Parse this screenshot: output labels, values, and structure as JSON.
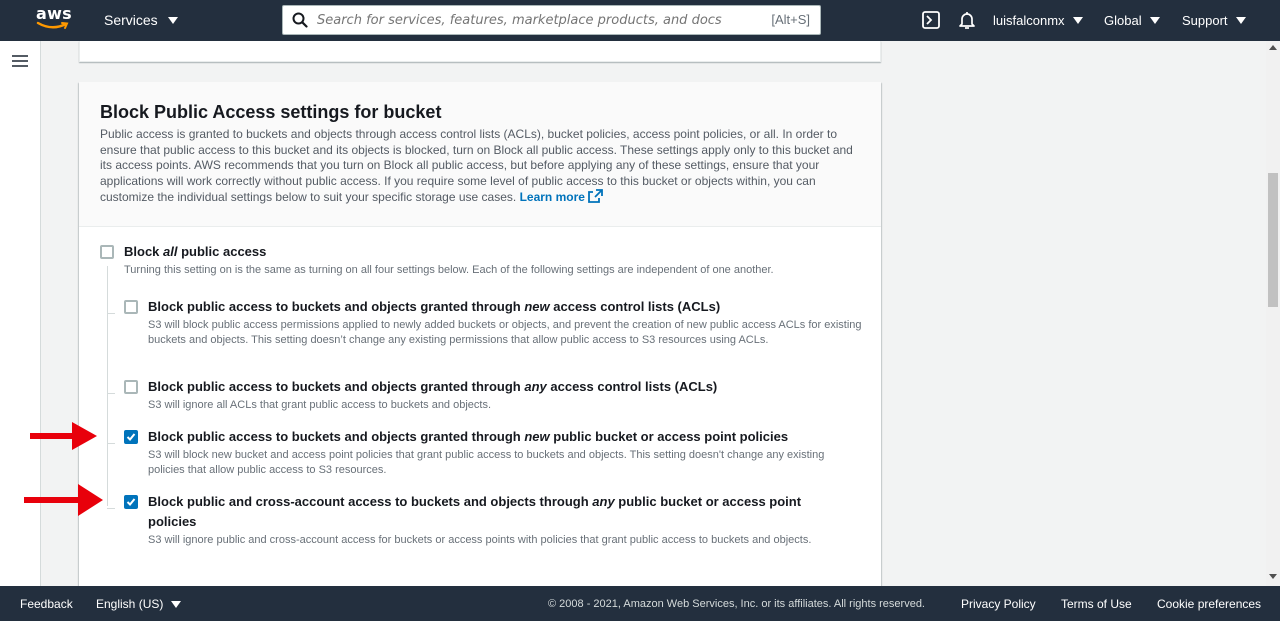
{
  "topnav": {
    "logo_text": "aws",
    "services_label": "Services",
    "search_placeholder": "Search for services, features, marketplace products, and docs",
    "search_shortcut": "[Alt+S]",
    "account_label": "luisfalconmx",
    "region_label": "Global",
    "support_label": "Support",
    "icons": [
      "cloudshell-icon",
      "bell-icon"
    ]
  },
  "card": {
    "title": "Block Public Access settings for bucket",
    "description": "Public access is granted to buckets and objects through access control lists (ACLs), bucket policies, access point policies, or all. In order to ensure that public access to this bucket and its objects is blocked, turn on Block all public access. These settings apply only to this bucket and its access points. AWS recommends that you turn on Block all public access, but before applying any of these settings, ensure that your applications will work correctly without public access. If you require some level of public access to this bucket or objects within, you can customize the individual settings below to suit your specific storage use cases.",
    "learn_more": "Learn more"
  },
  "block_all": {
    "title_pre": "Block ",
    "title_em": "all",
    "title_post": " public access",
    "description": "Turning this setting on is the same as turning on all four settings below. Each of the following settings are independent of one another.",
    "checked": false
  },
  "options": [
    {
      "title_pre": "Block public access to buckets and objects granted through ",
      "title_em": "new",
      "title_post": " access control lists (ACLs)",
      "description": "S3 will block public access permissions applied to newly added buckets or objects, and prevent the creation of new public access ACLs for existing buckets and objects. This setting doesn’t change any existing permissions that allow public access to S3 resources using ACLs.",
      "checked": false
    },
    {
      "title_pre": "Block public access to buckets and objects granted through ",
      "title_em": "any",
      "title_post": " access control lists (ACLs)",
      "description": "S3 will ignore all ACLs that grant public access to buckets and objects.",
      "checked": false
    },
    {
      "title_pre": "Block public access to buckets and objects granted through ",
      "title_em": "new",
      "title_post": " public bucket or access point policies",
      "description": "S3 will block new bucket and access point policies that grant public access to buckets and objects. This setting doesn't change any existing policies that allow public access to S3 resources.",
      "checked": true
    },
    {
      "title_pre": "Block public and cross-account access to buckets and objects through ",
      "title_em": "any",
      "title_post": " public bucket or access point policies",
      "description": "S3 will ignore public and cross-account access for buckets or access points with policies that grant public access to buckets and objects.",
      "checked": true
    }
  ],
  "footer": {
    "feedback": "Feedback",
    "language": "English (US)",
    "copyright": "© 2008 - 2021, Amazon Web Services, Inc. or its affiliates. All rights reserved.",
    "privacy": "Privacy Policy",
    "terms": "Terms of Use",
    "cookies": "Cookie preferences"
  },
  "colors": {
    "nav_bg": "#232f3e",
    "checkbox_checked": "#0073bb",
    "link": "#0073bb",
    "annotation_arrow": "#e8000b"
  }
}
